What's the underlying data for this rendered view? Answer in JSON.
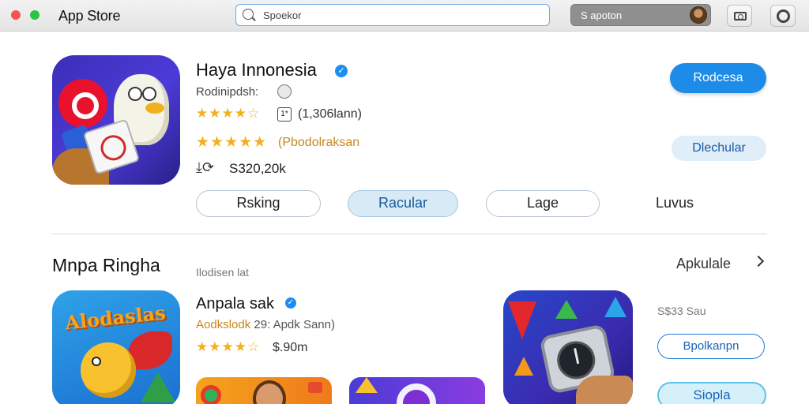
{
  "window": {
    "app_title": "App Store",
    "search": {
      "value": "Spoekor",
      "icon": "search-icon"
    },
    "account": {
      "label": "S apoton",
      "icon": "avatar"
    }
  },
  "featured": {
    "title": "Haya Innonesia",
    "developer": "Rodinipdsh:",
    "age_rating": "1*",
    "rating_count": "(1,306lann)",
    "editor_rating_label": "(Pbodolraksan",
    "downloads": "S320,20k",
    "primary_button": "Rodcesa",
    "secondary_button": "Dlechular",
    "tabs": [
      "Rsking",
      "Racular",
      "Lage",
      "Luvus"
    ],
    "colors": {
      "accent": "#1d8be8",
      "star": "#f2b01e"
    }
  },
  "section": {
    "title": "Mnpa Ringha",
    "subtitle": "Ilodisen lat",
    "see_all": "Apkulale",
    "app": {
      "title": "Anpala sak",
      "icon_text": "Alodaslas",
      "meta_accent": "Aodkslodk",
      "meta_rest": "29: Apdk Sann)",
      "price": "$.90m"
    },
    "side": {
      "price": "S$33 Sau",
      "button1": "Bpolkanpn",
      "button2": "Siopla"
    }
  }
}
